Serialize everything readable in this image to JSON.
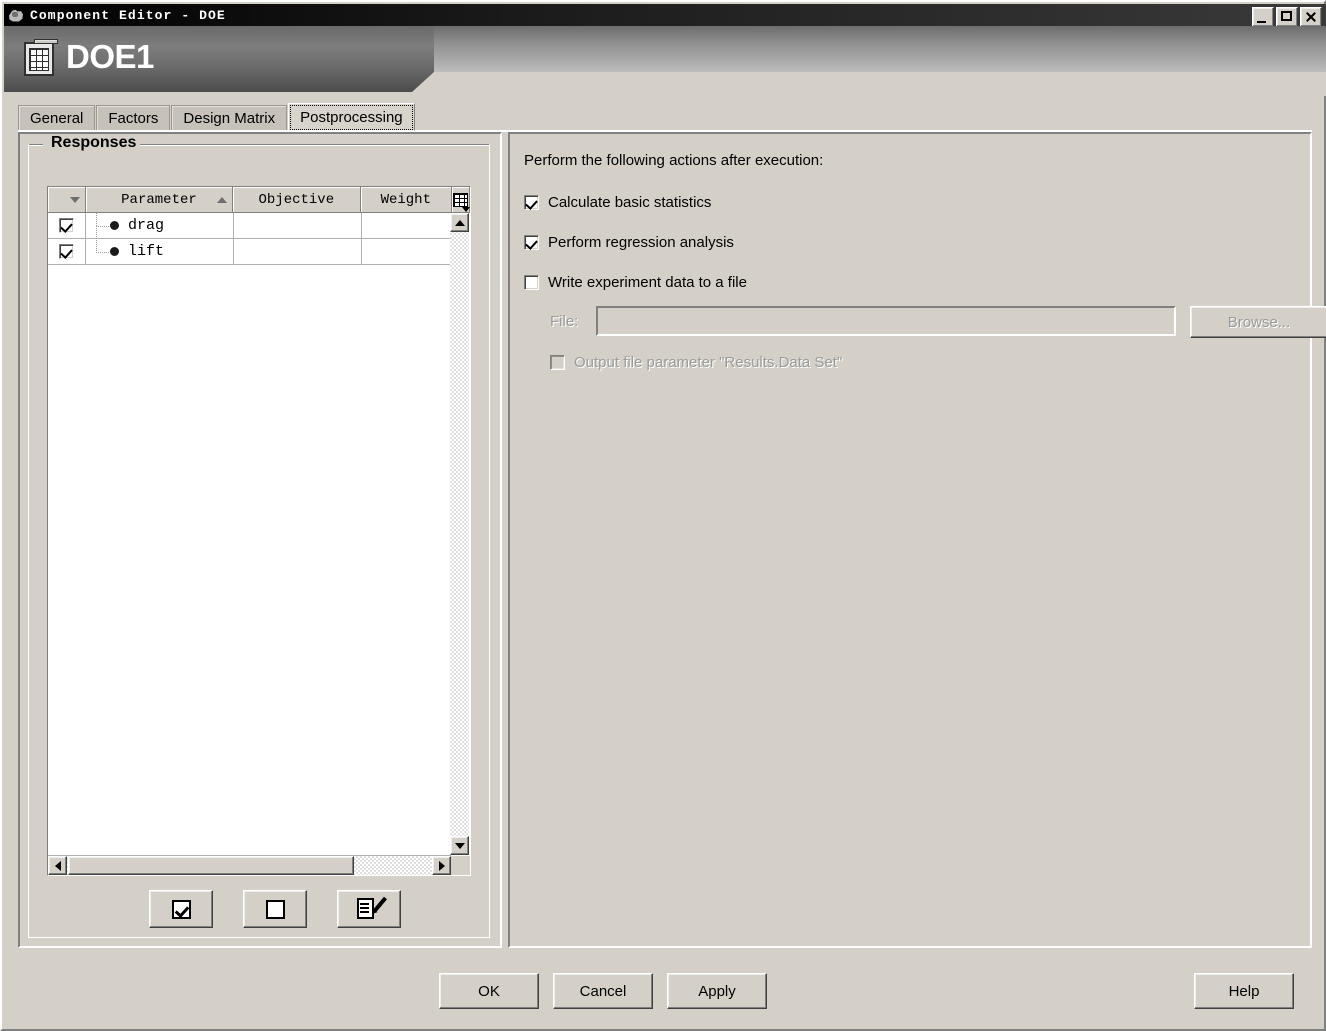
{
  "window": {
    "title": "Component Editor - DOE",
    "icon": "app-icon",
    "controls": {
      "minimize": "_",
      "maximize": "□",
      "close": "×"
    }
  },
  "banner": {
    "title": "DOE1",
    "icon": "doe-grid-icon"
  },
  "tabs": [
    {
      "label": "General",
      "selected": false
    },
    {
      "label": "Factors",
      "selected": false
    },
    {
      "label": "Design Matrix",
      "selected": false
    },
    {
      "label": "Postprocessing",
      "selected": true
    }
  ],
  "responses": {
    "group_label": "Responses",
    "columns": [
      "",
      "Parameter",
      "Objective",
      "Weight"
    ],
    "column_menu_icon": "table-column-chooser-icon",
    "sort": {
      "checkbox_column": "down",
      "parameter_column": "up"
    },
    "rows": [
      {
        "checked": true,
        "parameter": "drag",
        "objective": "",
        "weight": ""
      },
      {
        "checked": true,
        "parameter": "lift",
        "objective": "",
        "weight": ""
      }
    ],
    "toolbar": [
      {
        "name": "check-all-button",
        "icon": "checked-box-icon"
      },
      {
        "name": "uncheck-all-button",
        "icon": "empty-box-icon"
      },
      {
        "name": "edit-responses-button",
        "icon": "edit-document-icon"
      }
    ],
    "scrollbars": {
      "vertical": true,
      "horizontal": true
    }
  },
  "postprocessing": {
    "heading": "Perform the following actions after execution:",
    "options": [
      {
        "label": "Calculate basic statistics",
        "checked": true,
        "enabled": true
      },
      {
        "label": "Perform regression analysis",
        "checked": true,
        "enabled": true
      },
      {
        "label": "Write experiment data to a file",
        "checked": false,
        "enabled": true
      }
    ],
    "file": {
      "label": "File:",
      "value": "",
      "placeholder": "",
      "browse_label": "Browse...",
      "enabled": false
    },
    "output_param": {
      "label": "Output file parameter \"Results.Data Set\"",
      "checked": false,
      "enabled": false
    }
  },
  "footer": {
    "ok": "OK",
    "cancel": "Cancel",
    "apply": "Apply",
    "help": "Help"
  },
  "colors": {
    "face": "#d4d0c8",
    "banner_dark": "#6a6a6a",
    "title_bar": "#000000",
    "disabled_text": "#9b9b9b"
  }
}
